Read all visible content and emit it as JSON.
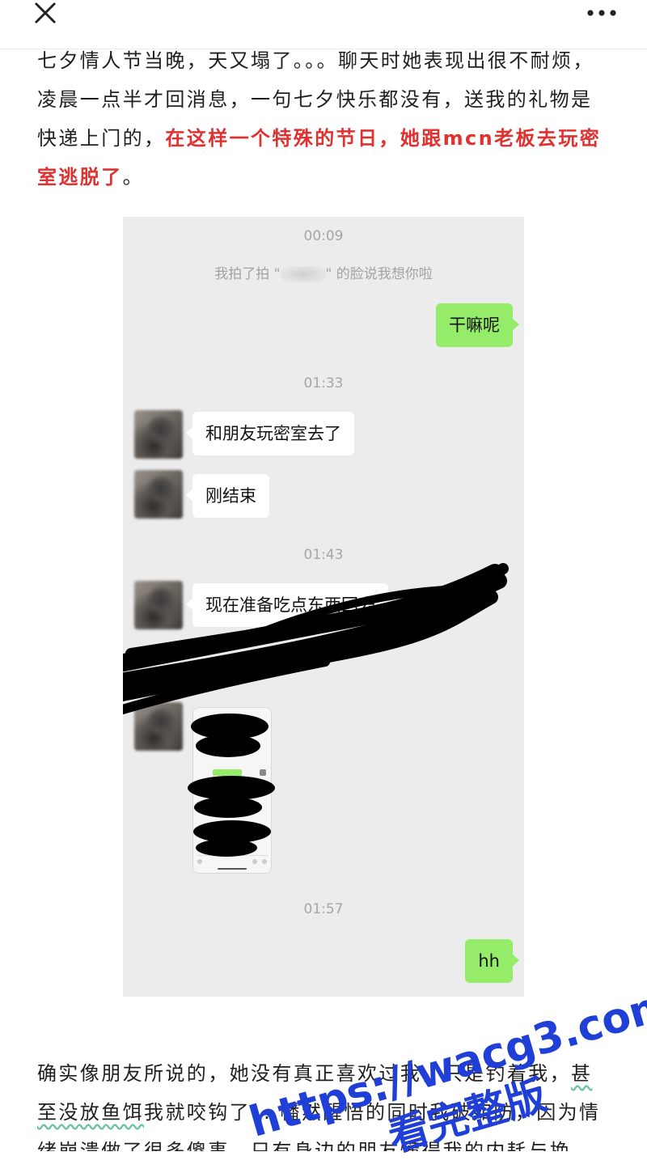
{
  "nav": {
    "close_icon": "close-icon",
    "more_icon": "more-icon"
  },
  "article": {
    "p1_text": "七夕情人节当晚，天又塌了。。。聊天时她表现出很不耐烦，凌晨一点半才回消息，一句七夕快乐都没有，送我的礼物是快递上门的，",
    "p1_highlight": "在这样一个特殊的节日，她跟mcn老板去玩密室逃脱了",
    "p1_end": "。",
    "p2_a": "确实像朋友所说的，她没有真正喜欢过我，只是钓着我，",
    "p2_underlined": "甚至没放鱼饵",
    "p2_b": "我就咬钩了… 幡然醒悟的同时我破如防，因为情绪崩溃做了很多傻事，只有身边的朋友懂得我的内耗与挽"
  },
  "chat": {
    "time1": "00:09",
    "sys_prefix": "我拍了拍 \"",
    "sys_suffix": "\" 的脸说我想你啦",
    "msg_me_1": "干嘛呢",
    "time2": "01:33",
    "msg_her_1": "和朋友玩密室去了",
    "msg_her_2": "刚结束",
    "time3": "01:43",
    "msg_her_3": "现在准备吃点东西回去",
    "time4": "01:57",
    "msg_me_2": "hh"
  },
  "watermark": {
    "line1": "https://wacg3.com",
    "line2": "看完整版"
  },
  "colors": {
    "highlight": "#e03131",
    "bubble_green": "#95ec69",
    "chat_bg": "#ececec",
    "watermark_blue": "#1f3fd6"
  }
}
